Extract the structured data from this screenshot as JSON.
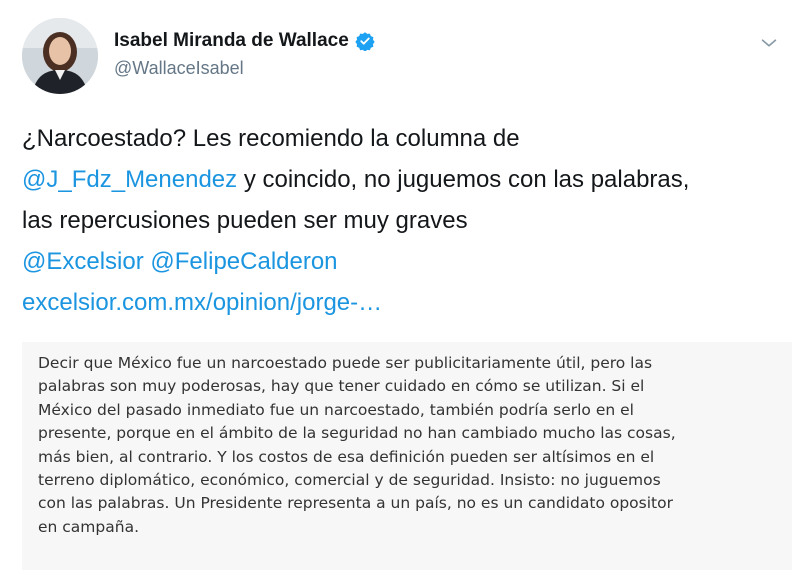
{
  "author": {
    "name": "Isabel Miranda de Wallace",
    "handle": "@WallaceIsabel",
    "verified": true,
    "avatar_icon": "profile-photo",
    "verified_color": "#1da1f2"
  },
  "menu": {
    "icon": "chevron-down-icon"
  },
  "tweet": {
    "line1": "¿Narcoestado? Les recomiendo la columna de",
    "mention1": "@J_Fdz_Menendez",
    "line2_rest": " y coincido, no juguemos con las palabras,",
    "line3": "las repercusiones pueden ser muy graves",
    "mention2": "@Excelsior",
    "mention3": "@FelipeCalderon",
    "link": "excelsior.com.mx/opinion/jorge-…"
  },
  "quote": {
    "lines": [
      "Decir que México fue un narcoestado puede ser publicitariamente útil, pero las",
      "palabras son muy poderosas, hay que tener cuidado en cómo se utilizan. Si el",
      "México del pasado inmediato fue un narcoestado, también podría serlo en el",
      "presente, porque en el ámbito de la seguridad no han cambiado mucho las cosas,",
      "más bien, al contrario. Y los costos de esa definición pueden ser altísimos en el",
      "terreno diplomático, económico, comercial y de seguridad. Insisto: no juguemos",
      "con las palabras. Un Presidente representa a un país, no es un candidato opositor",
      "en campaña."
    ]
  },
  "colors": {
    "link": "#1b95e0",
    "text": "#14171a",
    "secondary": "#657786",
    "quote_bg": "#f7f7f7"
  }
}
